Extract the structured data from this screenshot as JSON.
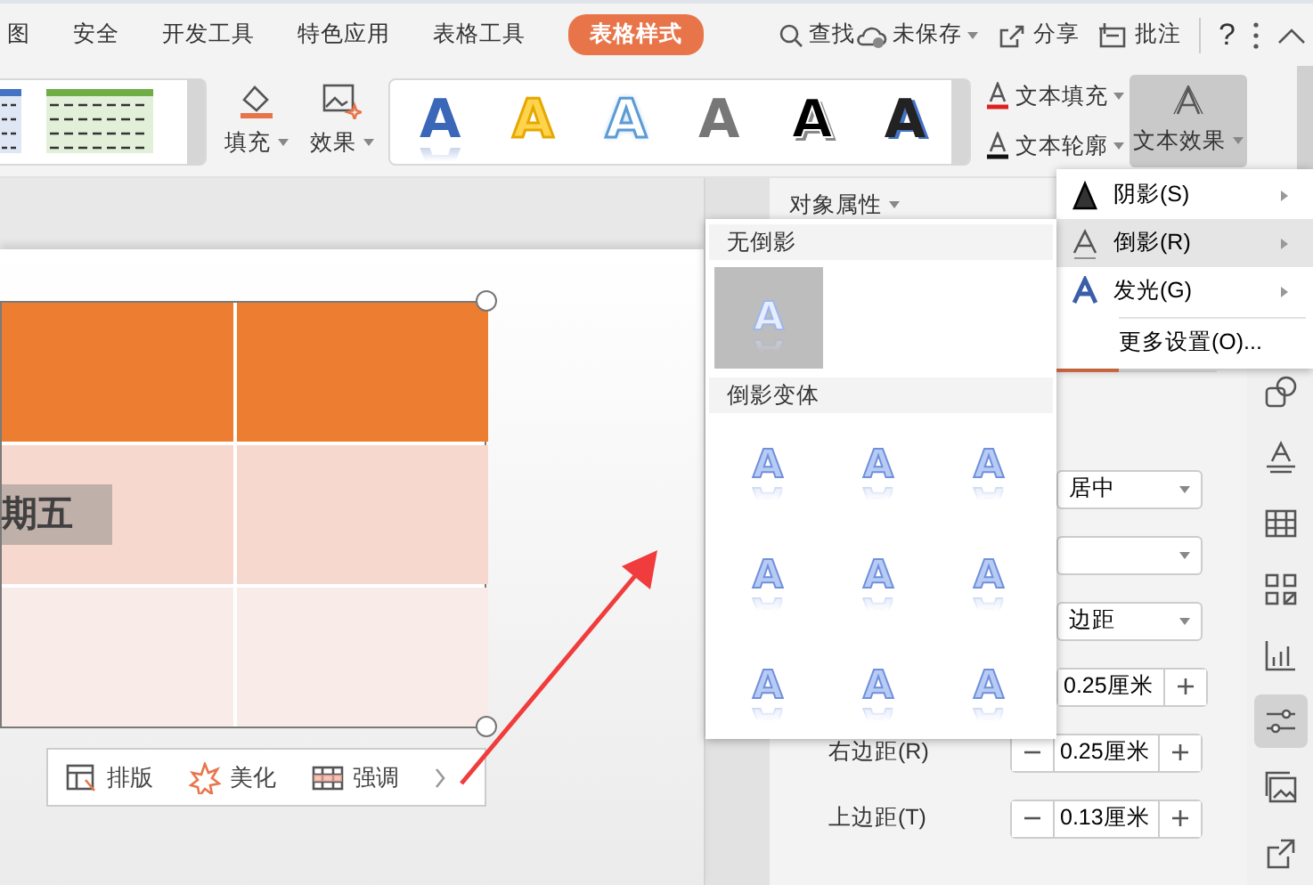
{
  "menu_bar": {
    "tabs": [
      {
        "label": "图",
        "selected": false
      },
      {
        "label": "安全",
        "selected": false
      },
      {
        "label": "开发工具",
        "selected": false
      },
      {
        "label": "特色应用",
        "selected": false
      },
      {
        "label": "表格工具",
        "selected": false
      },
      {
        "label": "表格样式",
        "selected": true
      }
    ],
    "search": "查找",
    "actions": [
      {
        "label": "未保存",
        "kind": "cloud"
      },
      {
        "label": "分享",
        "kind": "share"
      },
      {
        "label": "批注",
        "kind": "comment"
      }
    ],
    "help": "?"
  },
  "ribbon": {
    "fill_button": "填充",
    "effect_button": "效果",
    "text_styles": [
      {
        "kind": "blue",
        "letter": "A"
      },
      {
        "kind": "yellow",
        "letter": "A"
      },
      {
        "kind": "outline",
        "letter": "A"
      },
      {
        "kind": "gray",
        "letter": "A"
      },
      {
        "kind": "black",
        "letter": "A"
      },
      {
        "kind": "offset",
        "letter": "A"
      }
    ],
    "text_fill": "文本填充",
    "text_outline": "文本轮廓",
    "text_effect": {
      "label": "文本效果",
      "selected": true
    }
  },
  "effects_menu": {
    "items": [
      {
        "label": "阴影(S)",
        "kind": "shadow",
        "selected": false
      },
      {
        "label": "倒影(R)",
        "kind": "reflection",
        "selected": true
      },
      {
        "label": "发光(G)",
        "kind": "glow",
        "selected": false
      }
    ],
    "more": "更多设置(O)..."
  },
  "reflection_menu": {
    "none_header": "无倒影",
    "none_option": {
      "letter": "A",
      "selected": true
    },
    "variants_header": "倒影变体",
    "variants": [
      {
        "letter": "A",
        "selected": false
      },
      {
        "letter": "A",
        "selected": false
      },
      {
        "letter": "A",
        "selected": false
      },
      {
        "letter": "A",
        "selected": false
      },
      {
        "letter": "A",
        "selected": false
      },
      {
        "letter": "A",
        "selected": false
      },
      {
        "letter": "A",
        "selected": false
      },
      {
        "letter": "A",
        "selected": false
      },
      {
        "letter": "A",
        "selected": false
      }
    ]
  },
  "pane": {
    "title": "对象属性",
    "dropdowns": [
      {
        "kind": "select",
        "value": "居中"
      },
      {
        "kind": "select"
      },
      {
        "kind": "select",
        "value": "边距"
      }
    ],
    "spinners": [
      {
        "value": "0.25厘米"
      },
      {
        "label": "右边距(R)",
        "value": "0.25厘米"
      },
      {
        "label": "上边距(T)",
        "value": "0.13厘米"
      }
    ]
  },
  "sidebar": [
    {
      "kind": "shapes",
      "selected": false
    },
    {
      "kind": "text",
      "selected": false
    },
    {
      "kind": "table",
      "selected": false
    },
    {
      "kind": "grid",
      "selected": false
    },
    {
      "kind": "chart",
      "selected": false
    },
    {
      "kind": "sliders",
      "selected": true
    },
    {
      "kind": "picture",
      "selected": false
    },
    {
      "kind": "share",
      "selected": false
    }
  ],
  "slide": {
    "table_rows": [
      {
        "color": "#ed7d31"
      },
      {
        "color": "#f7d8cf",
        "text": "期五"
      },
      {
        "color": "#f9ebe8"
      }
    ]
  },
  "mini_toolbar": [
    {
      "label": "排版",
      "kind": "layout"
    },
    {
      "label": "美化",
      "kind": "beautify"
    },
    {
      "label": "强调",
      "kind": "emphasis"
    }
  ]
}
